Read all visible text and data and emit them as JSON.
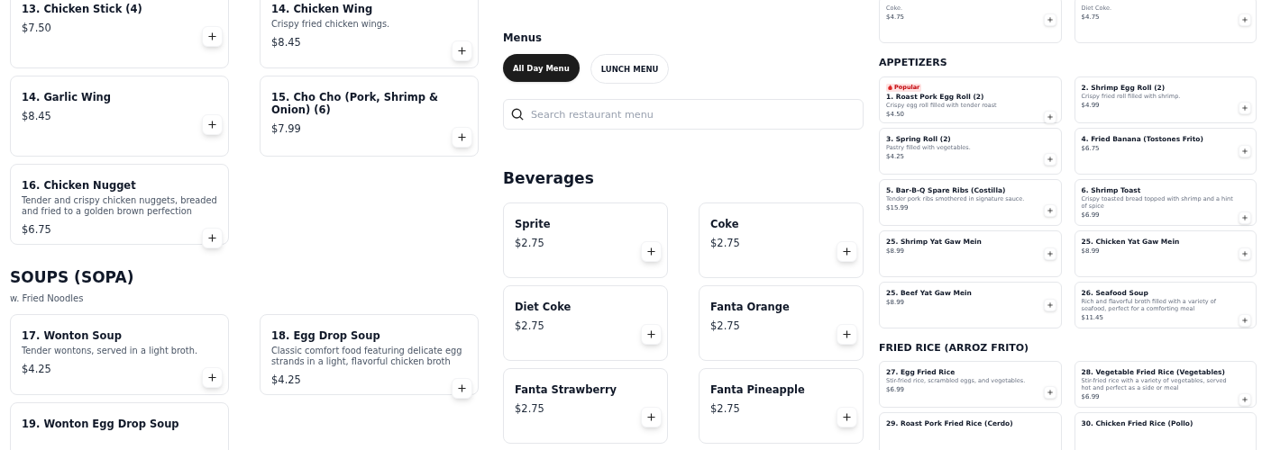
{
  "left_panel": {
    "sections": [
      {
        "items": [
          {
            "name": "13. Chicken Stick (4)",
            "price": "$7.50"
          },
          {
            "name": "14. Chicken Wing",
            "description": "Crispy fried chicken wings.",
            "price": "$8.45"
          },
          {
            "name": "14. Garlic Wing",
            "price": "$8.45"
          },
          {
            "name": "15. Cho Cho (Pork, Shrimp & Onion) (6)",
            "price": "$7.99"
          },
          {
            "name": "16. Chicken Nugget",
            "description": "Tender and crispy chicken nuggets, breaded and fried to a golden brown perfection",
            "price": "$6.75"
          }
        ]
      },
      {
        "title": "SOUPS (SOPA)",
        "subtitle": "w. Fried Noodles",
        "items": [
          {
            "name": "17. Wonton Soup",
            "description": "Tender wontons, served in a light broth.",
            "price": "$4.25"
          },
          {
            "name": "18. Egg Drop Soup",
            "description": "Classic comfort food featuring delicate egg strands in a light, flavorful chicken broth",
            "price": "$4.25"
          },
          {
            "name": "19. Wonton Egg Drop Soup"
          }
        ]
      }
    ]
  },
  "middle_panel": {
    "menus_label": "Menus",
    "menu_tabs": [
      {
        "label": "All Day Menu",
        "selected": true
      },
      {
        "label": "LUNCH MENU",
        "selected": false
      }
    ],
    "search": {
      "placeholder": "Search restaurant menu"
    },
    "sections": [
      {
        "title": "Beverages",
        "items": [
          {
            "name": "Sprite",
            "price": "$2.75"
          },
          {
            "name": "Coke",
            "price": "$2.75"
          },
          {
            "name": "Diet Coke",
            "price": "$2.75"
          },
          {
            "name": "Fanta Orange",
            "price": "$2.75"
          },
          {
            "name": "Fanta Strawberry",
            "price": "$2.75"
          },
          {
            "name": "Fanta Pineapple",
            "price": "$2.75"
          }
        ]
      }
    ]
  },
  "right_panel": {
    "sections": [
      {
        "items": [
          {
            "description": "Coke.",
            "price": "$4.75"
          },
          {
            "description": "Diet Coke.",
            "price": "$4.75"
          }
        ]
      },
      {
        "title": "APPETIZERS",
        "items": [
          {
            "badge": "Popular",
            "name": "1. Roast Pork Egg Roll (2)",
            "description": "Crispy egg roll filled with tender roast",
            "price": "$4.50"
          },
          {
            "name": "2. Shrimp Egg Roll (2)",
            "description": "Crispy fried roll filled with shrimp.",
            "price": "$4.99"
          },
          {
            "name": "3. Spring Roll (2)",
            "description": "Pastry filled with vegetables.",
            "price": "$4.25"
          },
          {
            "name": "4. Fried Banana (Tostones Frito)",
            "price": "$6.75"
          },
          {
            "name": "5. Bar-B-Q Spare Ribs (Costilla)",
            "description": "Tender pork ribs smothered in signature sauce.",
            "price": "$15.99"
          },
          {
            "name": "6. Shrimp Toast",
            "description": "Crispy toasted bread topped with shrimp and a hint of spice",
            "price": "$6.99"
          },
          {
            "name": "25. Shrimp Yat Gaw Mein",
            "price": "$8.99"
          },
          {
            "name": "25. Chicken Yat Gaw Mein",
            "price": "$8.99"
          },
          {
            "name": "25. Beef Yat Gaw Mein",
            "price": "$8.99"
          },
          {
            "name": "26. Seafood Soup",
            "description": "Rich and flavorful broth filled with a variety of seafood, perfect for a comforting meal",
            "price": "$11.45"
          }
        ]
      },
      {
        "title": "FRIED RICE (ARROZ FRITO)",
        "items": [
          {
            "name": "27. Egg Fried Rice",
            "description": "Stir-fried rice, scrambled eggs, and vegetables.",
            "price": "$6.99"
          },
          {
            "name": "28. Vegetable Fried Rice (Vegetables)",
            "description": "Stir-fried rice with a variety of vegetables, served hot and perfect as a side or meal",
            "price": "$6.99"
          },
          {
            "name": "29. Roast Pork Fried Rice (Cerdo)"
          },
          {
            "name": "30. Chicken Fried Rice (Pollo)"
          }
        ]
      }
    ]
  }
}
